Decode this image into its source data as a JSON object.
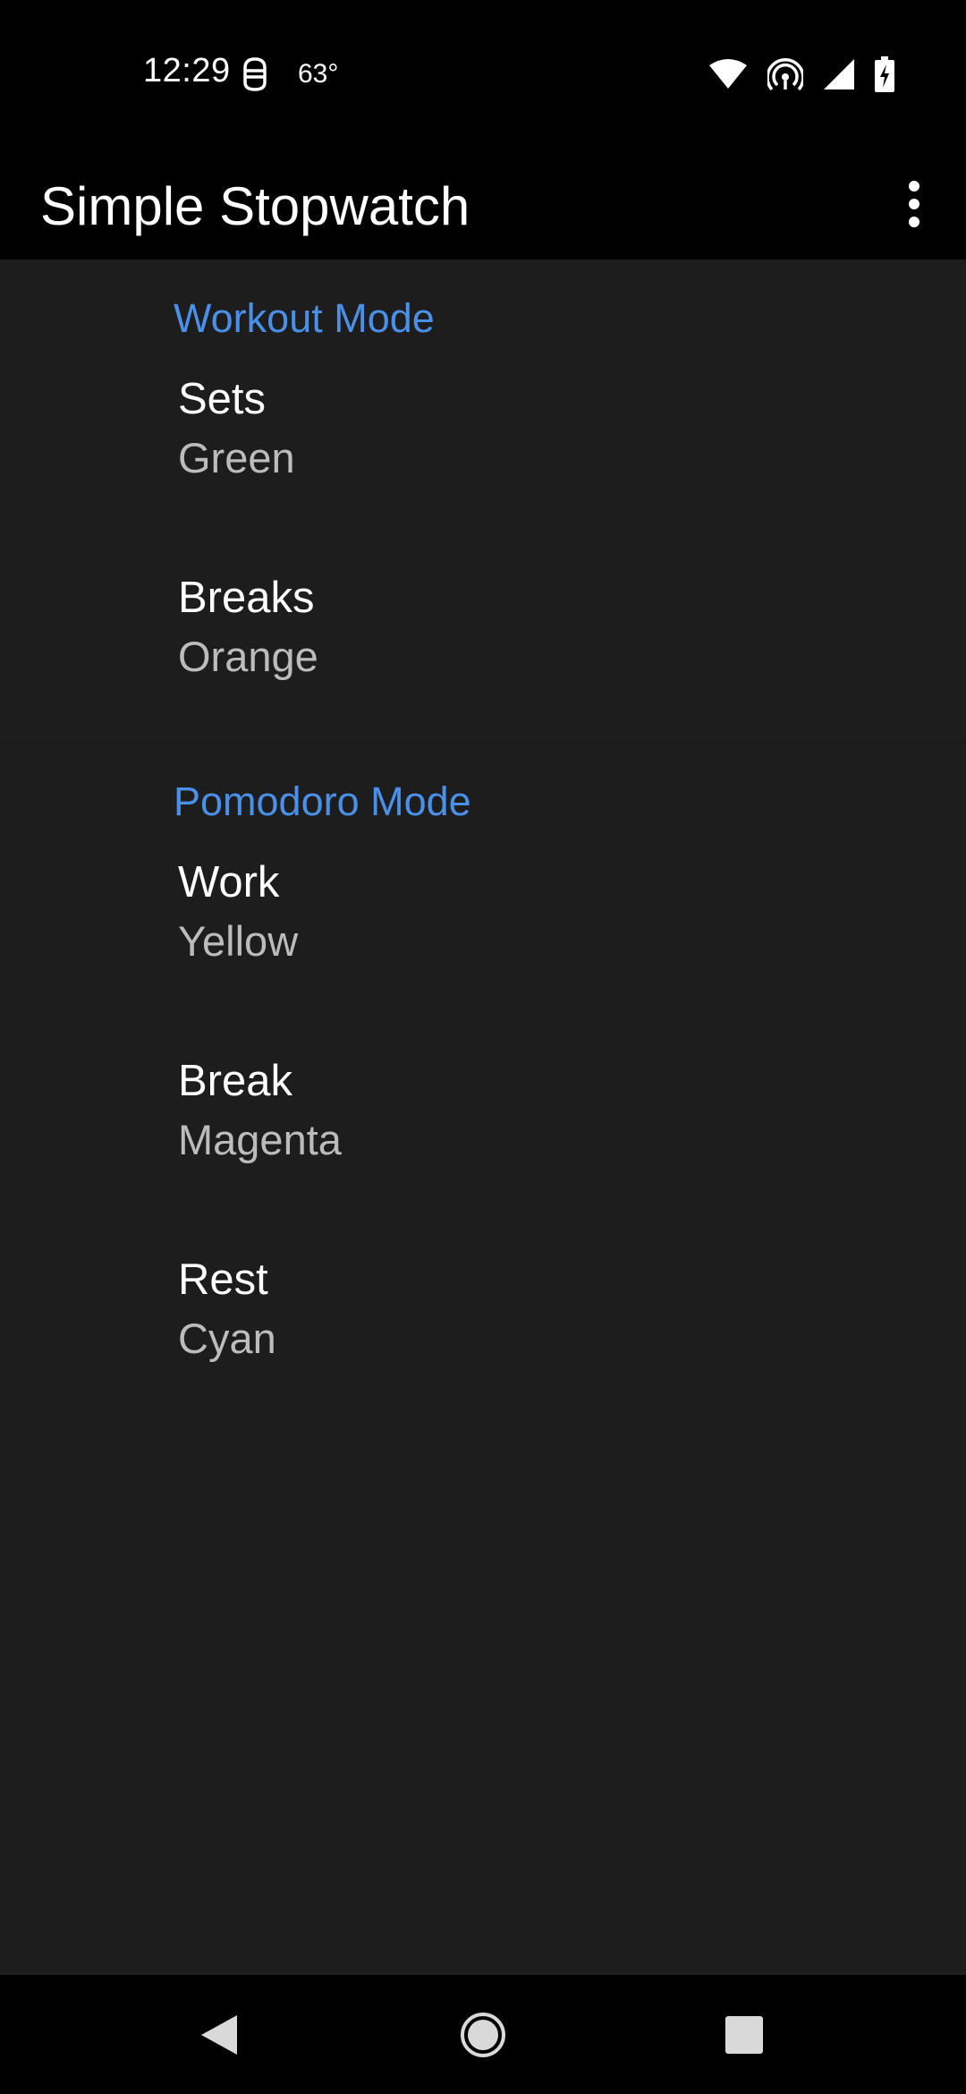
{
  "status_bar": {
    "time": "12:29",
    "temperature": "63°",
    "icons": [
      "app-notification-icon",
      "wifi-icon",
      "hotspot-icon",
      "cell-signal-icon",
      "battery-charging-icon"
    ]
  },
  "app_bar": {
    "title": "Simple Stopwatch",
    "menu_icon": "more-vert-icon"
  },
  "categories": [
    {
      "title": "Workout Mode",
      "items": [
        {
          "title": "Sets",
          "summary": "Green"
        },
        {
          "title": "Breaks",
          "summary": "Orange"
        }
      ]
    },
    {
      "title": "Pomodoro Mode",
      "items": [
        {
          "title": "Work",
          "summary": "Yellow"
        },
        {
          "title": "Break",
          "summary": "Magenta"
        },
        {
          "title": "Rest",
          "summary": "Cyan"
        }
      ]
    }
  ],
  "nav_bar": {
    "buttons": [
      "back-icon",
      "home-icon",
      "recents-icon"
    ]
  },
  "colors": {
    "accent": "#4a8fe8",
    "background": "#1d1d1d",
    "bars": "#000000"
  }
}
